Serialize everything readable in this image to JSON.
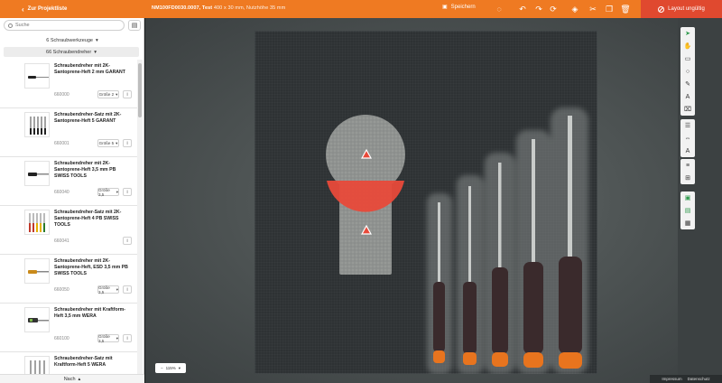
{
  "topbar": {
    "back_label": "Zur Projektliste",
    "project_title": "NM100FD0030.0007, Test",
    "project_subtitle": "400 x 30 mm, Nutzhöhe 35 mm",
    "save_label": "Speichern",
    "layout_label": "Layout ungültig",
    "accent": "#ef7a22",
    "alert": "#e0492f"
  },
  "sidebar": {
    "search_placeholder": "Suche",
    "filter_tools": "6 Schraubwerkzeuge",
    "filter_category": "66 Schraubendreher",
    "footer_label": "Nach",
    "products": [
      {
        "name": "Schraubendreher mit 2K-Santoprene-Heft 2 mm GARANT",
        "number": "660000",
        "size": "Größe 2"
      },
      {
        "name": "Schraubendreher-Satz mit 2K-Santoprene-Heft 5 GARANT",
        "number": "660001",
        "size": "Größe 5"
      },
      {
        "name": "Schraubendreher mit 2K-Santoprene-Heft 3,5 mm PB SWISS TOOLS",
        "number": "660040",
        "size": "Größe 3,5"
      },
      {
        "name": "Schraubendreher-Satz mit 2K-Santoprene-Heft 4 PB SWISS TOOLS",
        "number": "660041",
        "size": ""
      },
      {
        "name": "Schraubendreher mit 2K-Santoprene-Heft, ESD 3,5 mm PB SWISS TOOLS",
        "number": "660050",
        "size": "Größe 3,5"
      },
      {
        "name": "Schraubendreher mit Kraftform-Heft 3,5 mm WERA",
        "number": "660100",
        "size": "Größe 3,5"
      },
      {
        "name": "Schraubendreher-Satz mit Kraftform-Heft 5 WERA",
        "number": "",
        "size": ""
      }
    ]
  },
  "canvas": {
    "zoom_label": "115%"
  },
  "footer_links": {
    "imprint": "Impressum",
    "privacy": "Datenschutz"
  }
}
